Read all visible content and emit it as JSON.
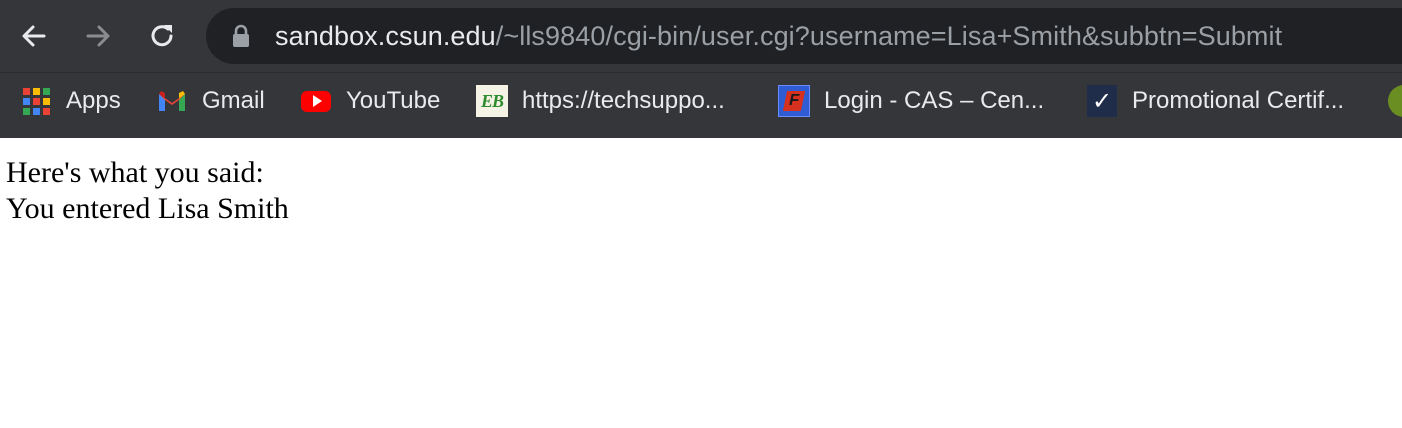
{
  "toolbar": {
    "back_icon": "arrow-left-icon",
    "forward_icon": "arrow-right-icon",
    "reload_icon": "reload-icon",
    "lock_icon": "lock-icon",
    "url_host": "sandbox.csun.edu",
    "url_path": "/~lls9840/cgi-bin/user.cgi?username=Lisa+Smith&subbtn=Submit"
  },
  "bookmarks": [
    {
      "label": "Apps",
      "icon": "apps-grid-icon"
    },
    {
      "label": "Gmail",
      "icon": "gmail-icon"
    },
    {
      "label": "YouTube",
      "icon": "youtube-icon"
    },
    {
      "label": "https://techsuppo...",
      "icon": "eb-icon"
    },
    {
      "label": "Login - CAS – Cen...",
      "icon": "cas-icon"
    },
    {
      "label": "Promotional Certif...",
      "icon": "checkmark-icon"
    }
  ],
  "colors": {
    "chrome_bg": "#35363a",
    "omnibox_bg": "#202124",
    "url_host": "#e8eaed",
    "url_path": "#9aa0a6"
  },
  "content": {
    "line1": "Here's what you said:",
    "line2": "You entered Lisa Smith"
  }
}
